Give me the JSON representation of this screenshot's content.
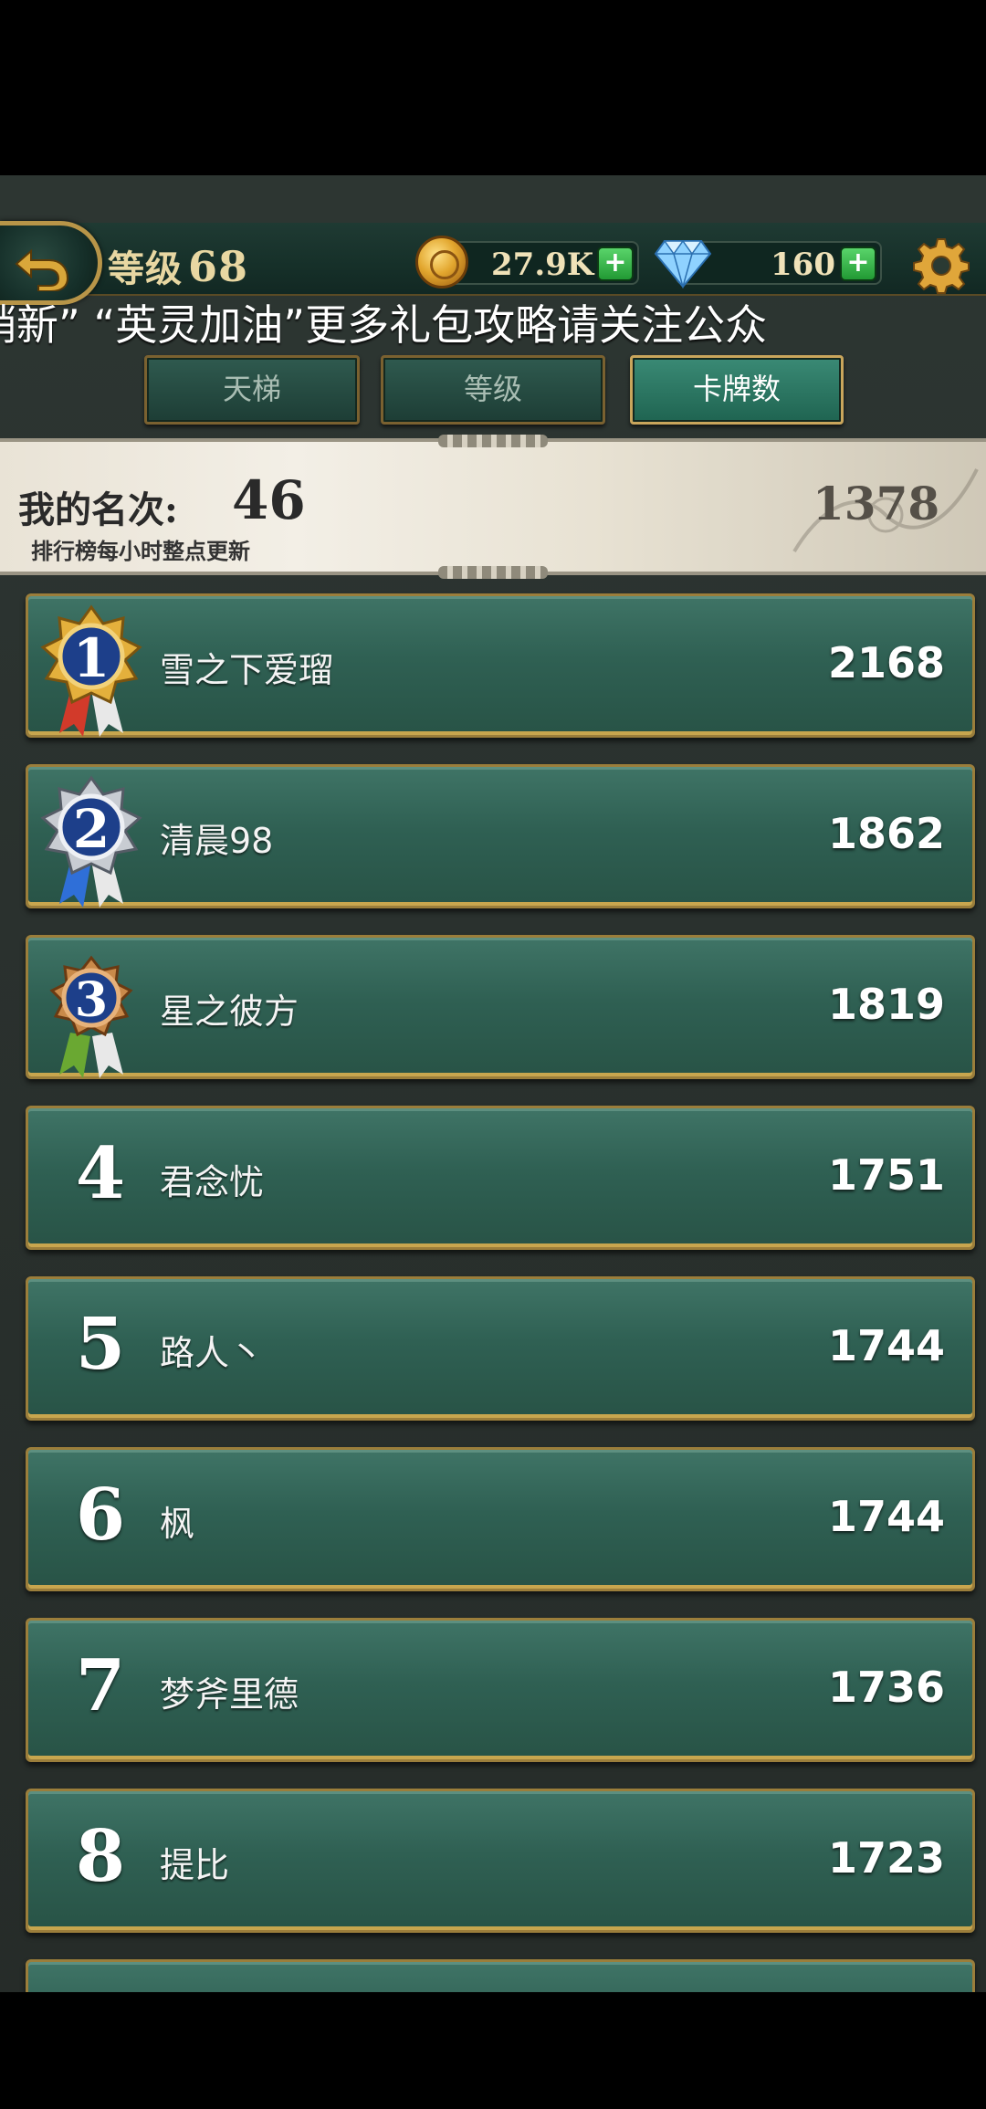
{
  "header": {
    "level_label": "等级",
    "level_value": "68",
    "gold_value": "27.9K",
    "gem_value": "160",
    "plus_symbol": "+",
    "icons": [
      "back-arrow-icon",
      "coin-icon",
      "diamond-icon",
      "plus-icon",
      "gear-icon"
    ]
  },
  "marquee": {
    "text": "销新”    “英灵加油”更多礼包攻略请关注公众"
  },
  "tabs": [
    {
      "label": "天梯",
      "active": false
    },
    {
      "label": "等级",
      "active": false
    },
    {
      "label": "卡牌数",
      "active": true
    }
  ],
  "my_rank": {
    "label": "我的名次:",
    "rank": "46",
    "note": "排行榜每小时整点更新",
    "score": "1378"
  },
  "leaderboard": [
    {
      "rank": "1",
      "name": "雪之下爱瑠",
      "score": "2168",
      "medal": "gold"
    },
    {
      "rank": "2",
      "name": "清晨98",
      "score": "1862",
      "medal": "silver"
    },
    {
      "rank": "3",
      "name": "星之彼方",
      "score": "1819",
      "medal": "bronze"
    },
    {
      "rank": "4",
      "name": "君念忧",
      "score": "1751"
    },
    {
      "rank": "5",
      "name": "路人丶",
      "score": "1744"
    },
    {
      "rank": "6",
      "name": "枫",
      "score": "1744"
    },
    {
      "rank": "7",
      "name": "梦斧里德",
      "score": "1736"
    },
    {
      "rank": "8",
      "name": "提比",
      "score": "1723"
    }
  ],
  "colors": {
    "row_green": "#2f6053",
    "gold_border": "#9b7e3b",
    "active_tab": "#3a8a75"
  }
}
